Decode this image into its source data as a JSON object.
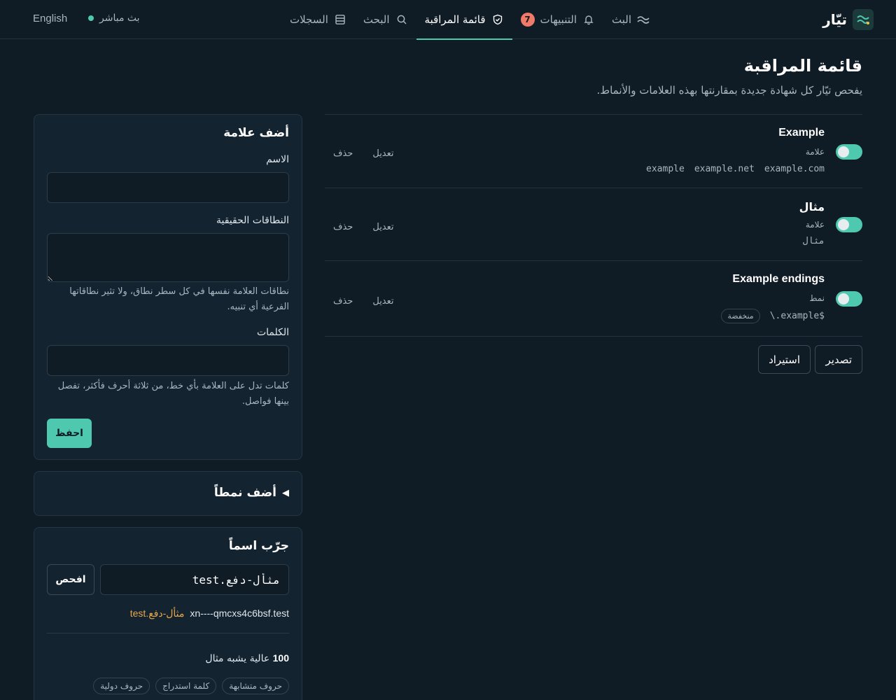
{
  "app": {
    "name": "تيّار",
    "live_label": "بث مباشر",
    "language_label": "English"
  },
  "nav": [
    {
      "label": "البث",
      "icon": "waves-icon"
    },
    {
      "label": "التنبيهات",
      "icon": "bell-icon",
      "badge": "7"
    },
    {
      "label": "قائمة المراقبة",
      "icon": "shield-check-icon",
      "active": true
    },
    {
      "label": "البحث",
      "icon": "search-icon"
    },
    {
      "label": "السجلات",
      "icon": "logs-icon"
    }
  ],
  "header": {
    "title": "قائمة المراقبة",
    "subtitle": "يفحص تيّار كل شهادة جديدة بمقارنتها بهذه العلامات والأنماط."
  },
  "watchlist": {
    "edit_label": "تعديل",
    "delete_label": "حذف",
    "rows": [
      {
        "name": "Example",
        "kind": "علامة",
        "terms": [
          "example.com",
          "example.net",
          "example"
        ],
        "enabled": true
      },
      {
        "name": "مثال",
        "kind": "علامة",
        "terms": [
          "مثال"
        ],
        "enabled": true
      },
      {
        "name": "Example endings",
        "kind": "نمط",
        "terms": [
          "\\.example$"
        ],
        "severity": "منخفضة",
        "enabled": true
      }
    ],
    "export_label": "تصدير",
    "import_label": "استيراد"
  },
  "add_brand": {
    "title": "أضف علامة",
    "name_label": "الاسم",
    "domains_label": "النطاقات الحقيقية",
    "domains_hint": "نطاقات العلامة نفسها في كل سطر نطاق، ولا تثير نطاقاتها الفرعية أي تنبيه.",
    "keywords_label": "الكلمات",
    "keywords_hint": "كلمات تدل على العلامة بأي خط، من ثلاثة أحرف فأكثر، تفصل بينها فواصل.",
    "save_label": "احفظ"
  },
  "add_pattern": {
    "title": "أضف نمطاً"
  },
  "probe": {
    "title": "جرّب اسماً",
    "input_value": "مثأل-دفع.test",
    "button_label": "افحص",
    "result_ascii": "xn----qmcxs4c6bsf.test",
    "result_unicode": "مثأل-دفع.test",
    "score": "100",
    "score_text": "عالية يشبه مثال",
    "tags": [
      "حروف متشابهة",
      "كلمة استدراج",
      "حروف دولية"
    ]
  },
  "colors": {
    "background": "#0f1b25",
    "accent": "#4ec9b0",
    "badge": "#f07a6a",
    "warning": "#e8a84a"
  }
}
